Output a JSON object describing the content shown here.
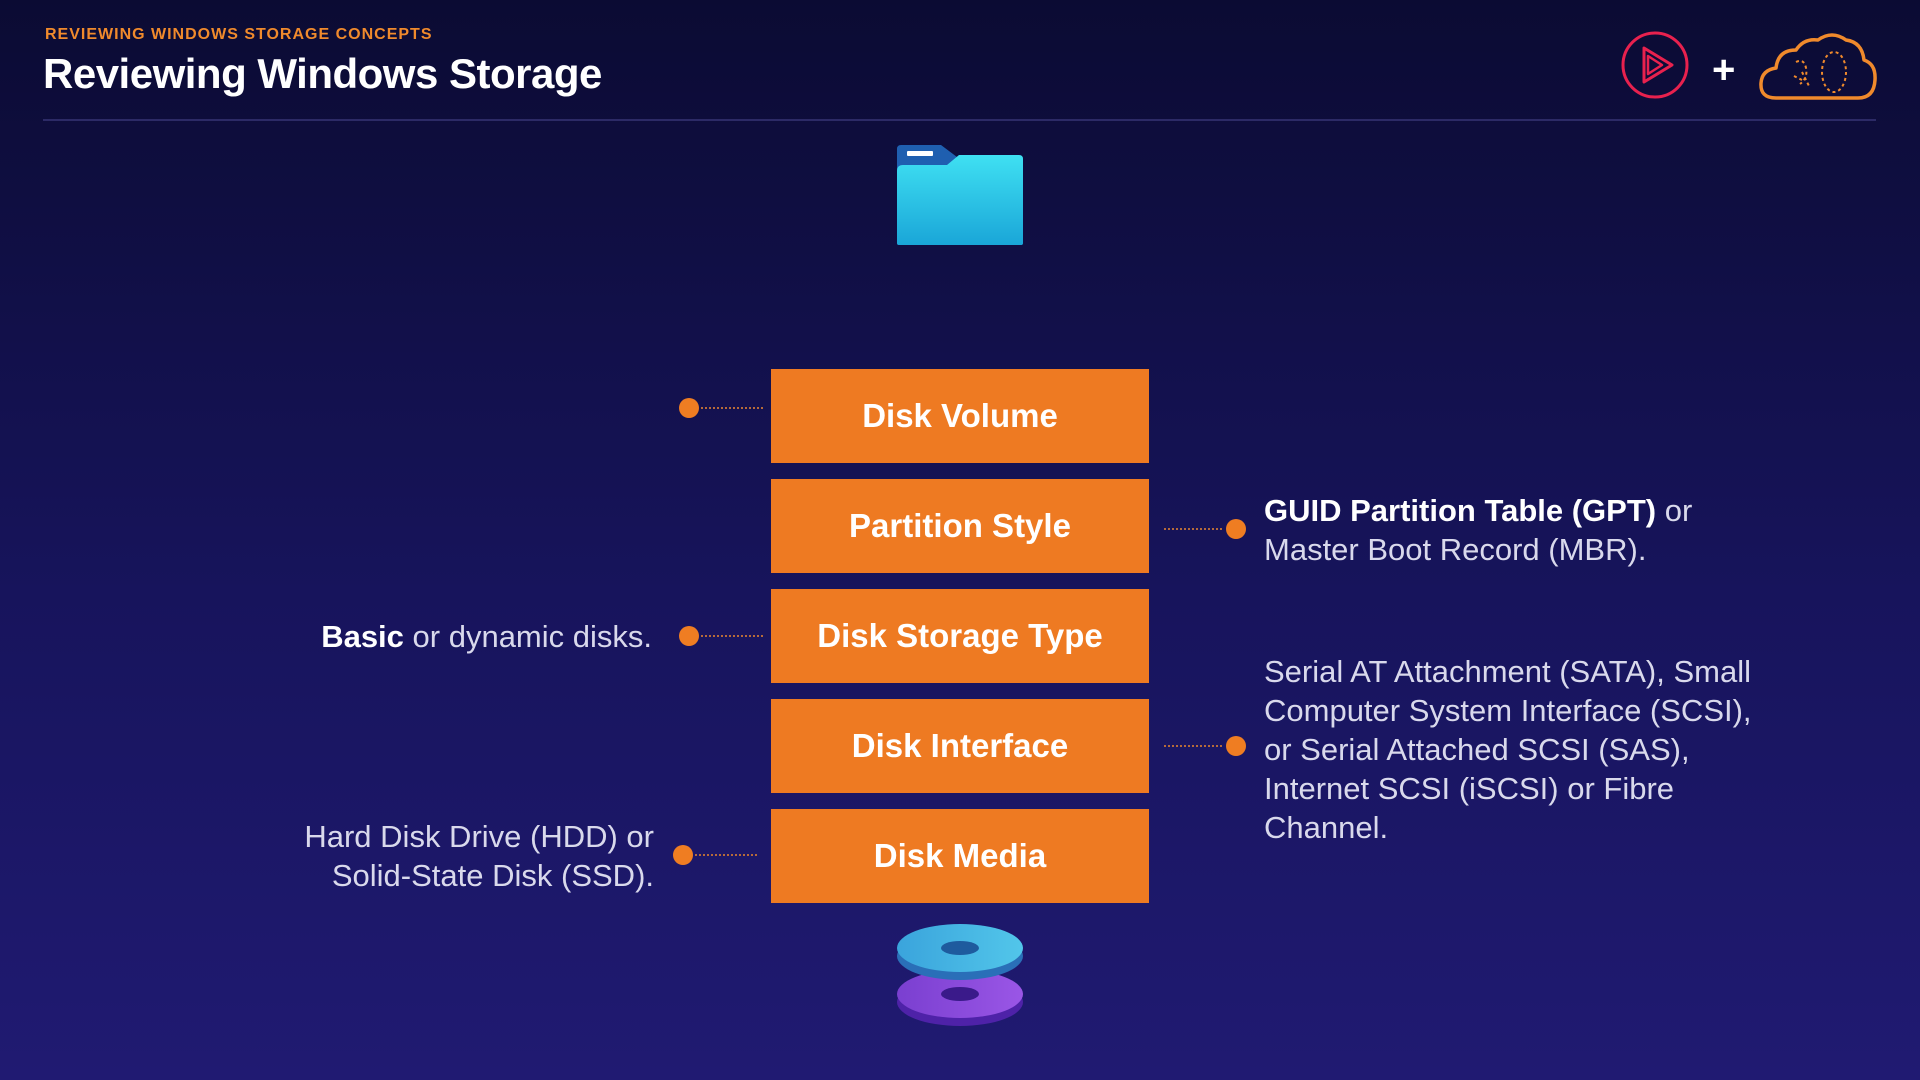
{
  "header": {
    "kicker": "REVIEWING WINDOWS STORAGE CONCEPTS",
    "title": "Reviewing Windows Storage",
    "plus": "+"
  },
  "icons": {
    "folder": "folder-icon",
    "disks": "stacked-disks-icon",
    "play_logo": "play-logo-icon",
    "cloud_logo": "cloud-logo-icon"
  },
  "colors": {
    "accent": "#ee7a22",
    "kicker": "#f08a2c",
    "background_top": "#0b0b33",
    "background_bottom": "#201a72"
  },
  "layers": [
    {
      "label": "Disk Volume"
    },
    {
      "label": "Partition Style"
    },
    {
      "label": "Disk Storage Type"
    },
    {
      "label": "Disk Interface"
    },
    {
      "label": "Disk Media"
    }
  ],
  "notes": {
    "partition_style": {
      "bold": "GUID Partition Table (GPT)",
      "rest_line1": " or",
      "line2": "Master Boot Record (MBR)."
    },
    "storage_type": {
      "bold": "Basic",
      "rest": " or dynamic disks."
    },
    "interface": {
      "line1": "Serial AT Attachment (SATA), Small",
      "line2": "Computer System Interface (SCSI),",
      "line3": "or Serial Attached SCSI (SAS),",
      "line4": "Internet SCSI (iSCSI) or Fibre",
      "line5": "Channel."
    },
    "media": {
      "line1": "Hard Disk Drive (HDD) or",
      "line2": "Solid-State Disk (SSD)."
    }
  }
}
